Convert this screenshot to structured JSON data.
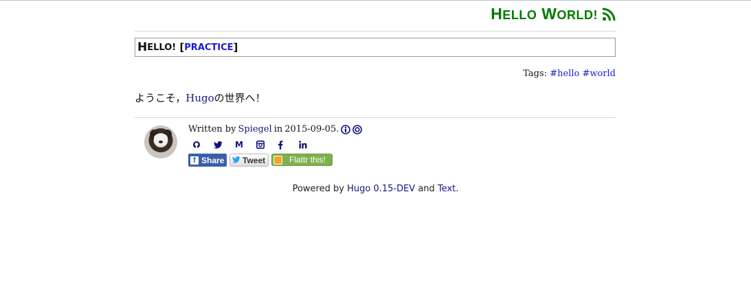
{
  "site": {
    "title_first_cap": "H",
    "title_first_rest": "ello",
    "title_second_cap": "W",
    "title_second_rest": "orld!",
    "icon": "rss-icon",
    "accent_color": "#007a00"
  },
  "article": {
    "title_cap": "H",
    "title_rest": "ello!",
    "title_bracket_open": " [",
    "category": "practice",
    "title_bracket_close": "]",
    "tags_label": "Tags:",
    "tags": [
      "#hello",
      "#world"
    ],
    "body_before": "ようこそ，",
    "body_link": "Hugo",
    "body_after": "の世界へ！"
  },
  "author": {
    "written_by": "Written by",
    "name": "Spiegel",
    "in": "in",
    "date": "2015-09-05.",
    "license_icons": [
      "cc-by-icon",
      "cc-sa-icon"
    ],
    "social": [
      "github-icon",
      "twitter-icon",
      "medium-icon",
      "instagram-icon",
      "facebook-icon",
      "linkedin-icon"
    ]
  },
  "share": {
    "facebook": "Share",
    "twitter": "Tweet",
    "flattr": "Flattr this!"
  },
  "footer": {
    "powered_by": "Powered by",
    "hugo": "Hugo 0.15-DEV",
    "and": "and",
    "theme": "Text",
    "period": "."
  }
}
